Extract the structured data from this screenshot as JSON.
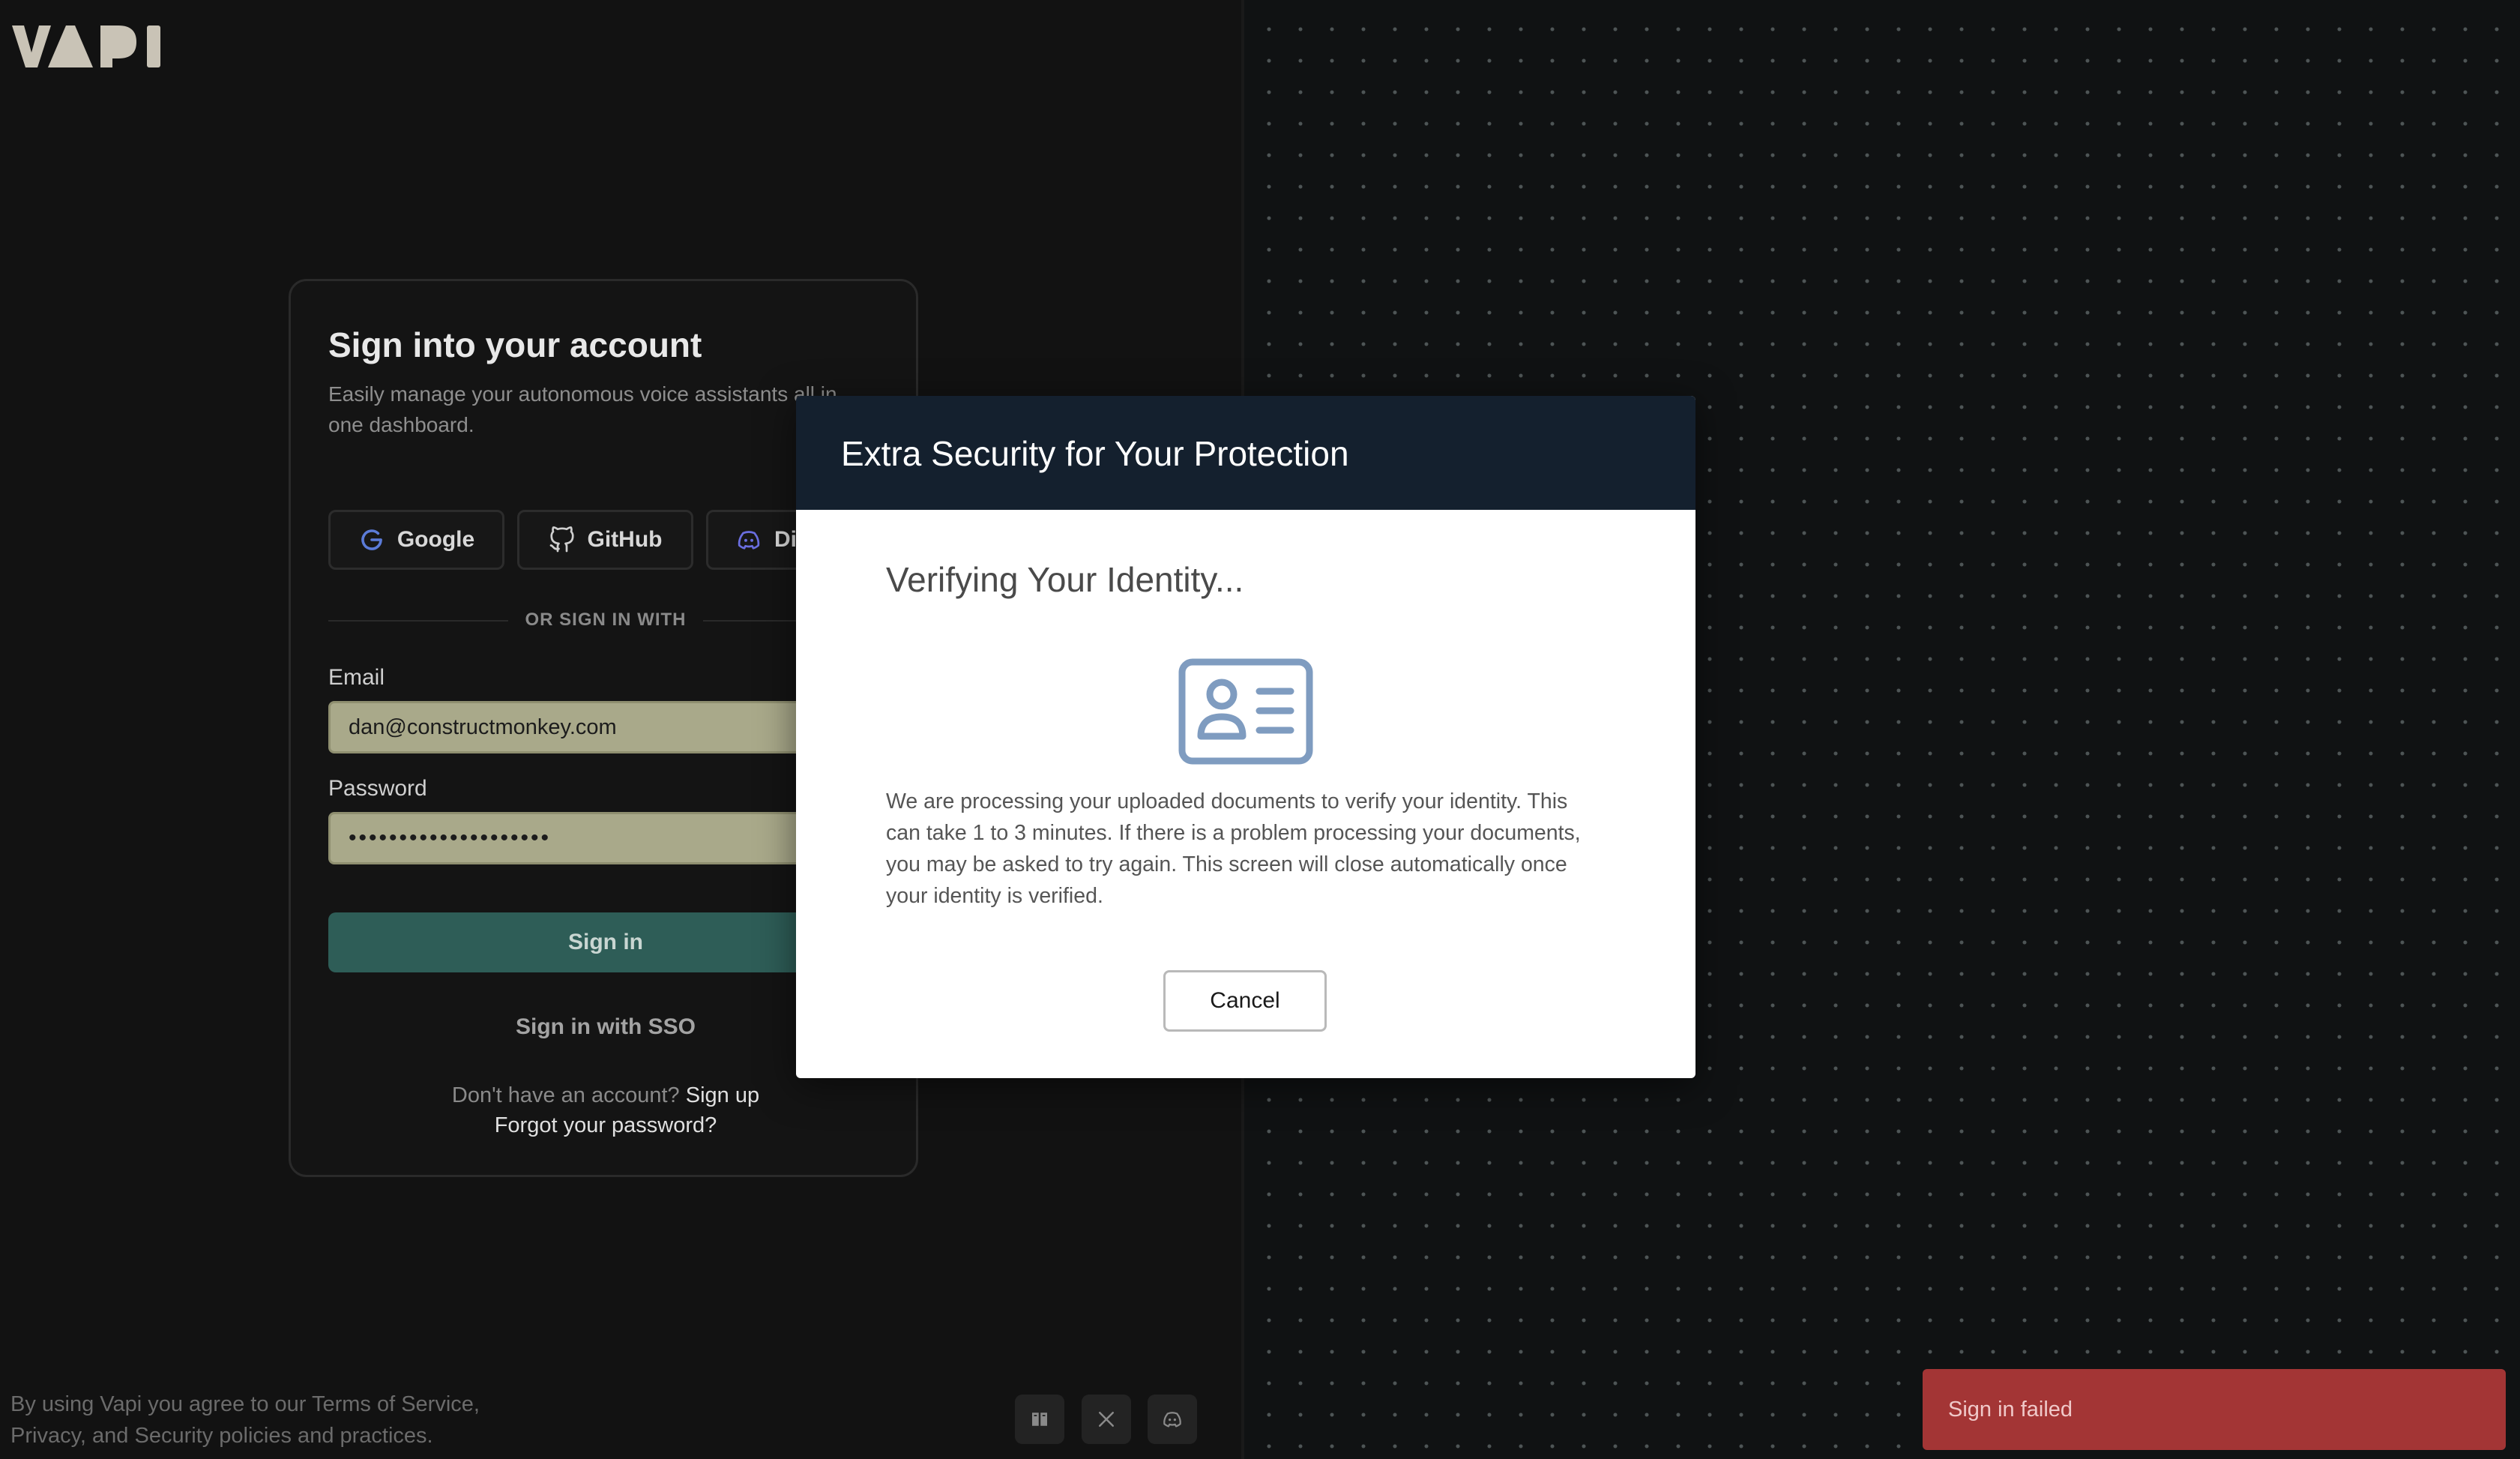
{
  "brand": {
    "logo_text": "VAPI"
  },
  "login": {
    "title": "Sign into your account",
    "subtitle": "Easily manage your autonomous voice assistants all in one dashboard.",
    "oauth": {
      "google": "Google",
      "github": "GitHub",
      "discord": "Di"
    },
    "divider": "OR SIGN IN WITH",
    "email_label": "Email",
    "email_value": "dan@constructmonkey.com",
    "password_label": "Password",
    "password_value": "••••••••••••••••••••",
    "signin_button": "Sign in",
    "sso_link": "Sign in with SSO",
    "no_account": "Don't have an account?",
    "signup_link": "Sign up",
    "forgot_link": "Forgot your password?"
  },
  "footer": {
    "terms": "By using Vapi you agree to our Terms of Service, Privacy, and Security policies and practices.",
    "social_icons": [
      "book-icon",
      "x-icon",
      "discord-icon"
    ]
  },
  "modal": {
    "title": "Extra Security for Your Protection",
    "heading": "Verifying Your Identity...",
    "icon": "id-card-icon",
    "body": "We are processing your uploaded documents to verify your identity. This can take 1 to 3 minutes. If there is a problem processing your documents, you may be asked to try again. This screen will close automatically once your identity is verified.",
    "cancel_button": "Cancel"
  },
  "toast": {
    "message": "Sign in failed",
    "color": "#a33535"
  },
  "colors": {
    "modal_header": "#14202e",
    "primary_button": "#2e5d57",
    "autofill_field": "#a9a98a",
    "icon_blue": "#7f9cc0"
  }
}
